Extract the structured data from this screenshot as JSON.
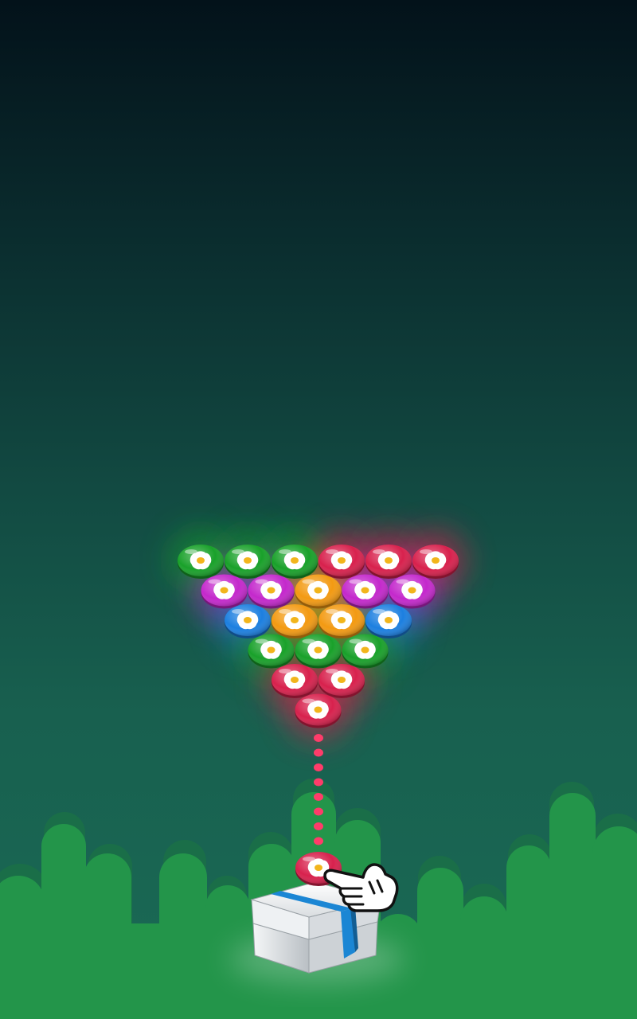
{
  "game": {
    "grid": [
      [
        "green",
        "green",
        "green",
        "red",
        "red",
        "red"
      ],
      [
        "purple",
        "purple",
        "orange",
        "purple",
        "purple"
      ],
      [
        "blue",
        "orange",
        "orange",
        "blue"
      ],
      [
        "green",
        "green",
        "green"
      ],
      [
        "red",
        "red"
      ],
      [
        "red"
      ]
    ],
    "shooter_bubble": "red",
    "aim_dots": 8,
    "hint": "tap-to-shoot-hand-icon"
  },
  "colors": {
    "green": "#19a12a",
    "red": "#d8214d",
    "purple": "#c428cc",
    "orange": "#f39a12",
    "blue": "#1c7fe0",
    "aim_dot": "#ff3c6a",
    "hills": "#23954a",
    "hills_back": "#1a6e48",
    "box_ribbon": "#1b86d4",
    "flower": "#ffffff",
    "flower_center": "#f2b51c"
  },
  "icons": [
    "flower-bubble-icon",
    "gift-box-icon",
    "pointing-hand-icon"
  ]
}
